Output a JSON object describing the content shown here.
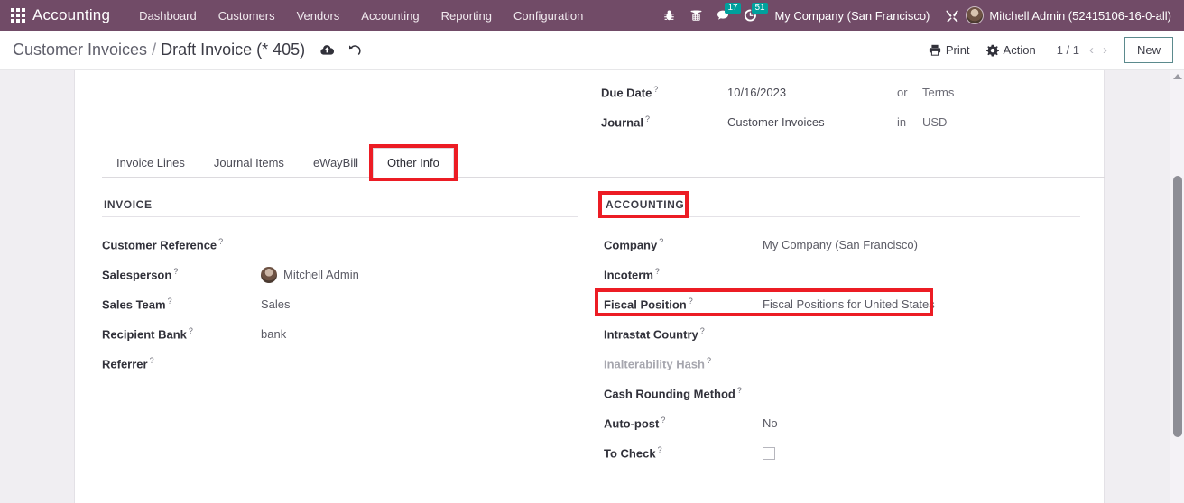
{
  "navbar": {
    "apps_icon": "apps-grid-icon",
    "brand": "Accounting",
    "menu": [
      {
        "label": "Dashboard"
      },
      {
        "label": "Customers"
      },
      {
        "label": "Vendors"
      },
      {
        "label": "Accounting"
      },
      {
        "label": "Reporting"
      },
      {
        "label": "Configuration"
      }
    ],
    "icons": [
      {
        "name": "bug-icon",
        "badge": null
      },
      {
        "name": "phone-dialpad-icon",
        "badge": null
      },
      {
        "name": "messages-icon",
        "badge": "17"
      },
      {
        "name": "activities-clock-icon",
        "badge": "51"
      }
    ],
    "company": "My Company (San Francisco)",
    "tools_icon": "tools-icon",
    "user": "Mitchell Admin (52415106-16-0-all)"
  },
  "control_panel": {
    "breadcrumb_parent": "Customer Invoices",
    "breadcrumb_separator": "/",
    "breadcrumb_current": "Draft Invoice (* 405)",
    "save_icon": "cloud-upload-icon",
    "discard_icon": "undo-icon",
    "print_label": "Print",
    "print_icon": "printer-icon",
    "action_label": "Action",
    "action_icon": "gear-icon",
    "pager": "1 / 1",
    "pager_prev": "‹",
    "pager_next": "›",
    "new_label": "New"
  },
  "top_fields": [
    {
      "label": "Due Date",
      "help": "?",
      "value": "10/16/2023",
      "connector": "or",
      "tail": "Terms"
    },
    {
      "label": "Journal",
      "help": "?",
      "value": "Customer Invoices",
      "connector": "in",
      "tail": "USD"
    }
  ],
  "tabs": [
    {
      "label": "Invoice Lines",
      "active": false
    },
    {
      "label": "Journal Items",
      "active": false
    },
    {
      "label": "eWayBill",
      "active": false
    },
    {
      "label": "Other Info",
      "active": true
    }
  ],
  "invoice_group": {
    "title": "INVOICE",
    "fields": [
      {
        "label": "Customer Reference",
        "help": "?",
        "value": "",
        "muted": false,
        "avatar": false
      },
      {
        "label": "Salesperson",
        "help": "?",
        "value": "Mitchell Admin",
        "muted": false,
        "avatar": true
      },
      {
        "label": "Sales Team",
        "help": "?",
        "value": "Sales",
        "muted": false,
        "avatar": false
      },
      {
        "label": "Recipient Bank",
        "help": "?",
        "value": "bank",
        "muted": false,
        "avatar": false
      },
      {
        "label": "Referrer",
        "help": "?",
        "value": "",
        "muted": false,
        "avatar": false
      }
    ]
  },
  "accounting_group": {
    "title": "ACCOUNTING",
    "fields": [
      {
        "label": "Company",
        "help": "?",
        "value": "My Company (San Francisco)",
        "muted": false,
        "checkbox": false
      },
      {
        "label": "Incoterm",
        "help": "?",
        "value": "",
        "muted": false,
        "checkbox": false
      },
      {
        "label": "Fiscal Position",
        "help": "?",
        "value": "Fiscal Positions for United States",
        "muted": false,
        "checkbox": false
      },
      {
        "label": "Intrastat Country",
        "help": "?",
        "value": "",
        "muted": false,
        "checkbox": false
      },
      {
        "label": "Inalterability Hash",
        "help": "?",
        "value": "",
        "muted": true,
        "checkbox": false
      },
      {
        "label": "Cash Rounding Method",
        "help": "?",
        "value": "",
        "muted": false,
        "checkbox": false
      },
      {
        "label": "Auto-post",
        "help": "?",
        "value": "No",
        "muted": false,
        "checkbox": false
      },
      {
        "label": "To Check",
        "help": "?",
        "value": "",
        "muted": false,
        "checkbox": true
      }
    ]
  },
  "annotations": {
    "color": "#ec1c24",
    "targets": [
      "Other Info tab",
      "ACCOUNTING section title",
      "Fiscal Position row"
    ]
  }
}
